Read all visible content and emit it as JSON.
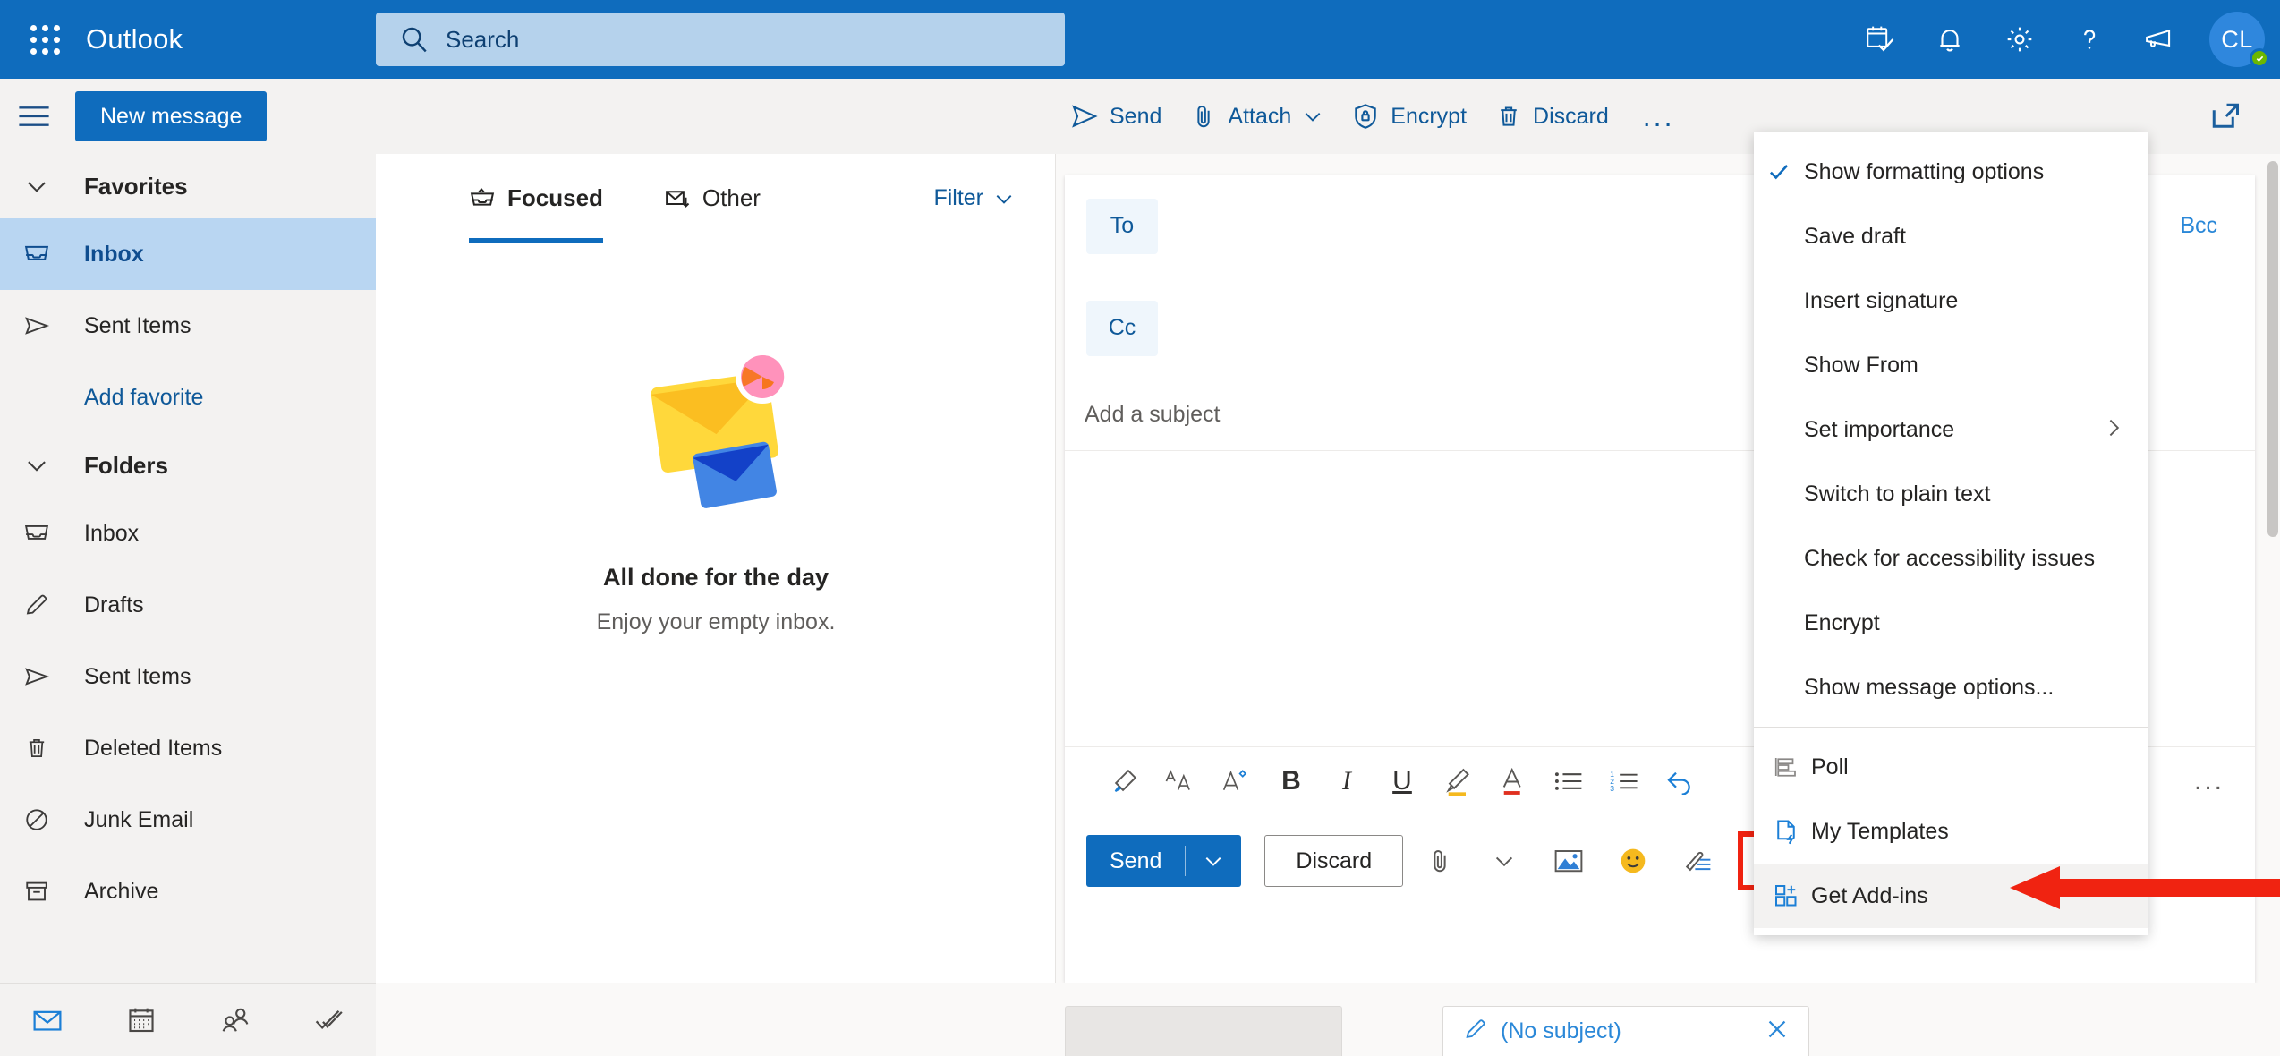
{
  "header": {
    "waffle_label": "app-launcher",
    "brand": "Outlook",
    "search": {
      "placeholder": "Search",
      "value": ""
    },
    "icons": [
      {
        "name": "calendar-check-icon",
        "label": "My day"
      },
      {
        "name": "bell-icon",
        "label": "Notifications"
      },
      {
        "name": "gear-icon",
        "label": "Settings"
      },
      {
        "name": "help-icon",
        "label": "Help"
      },
      {
        "name": "megaphone-icon",
        "label": "Feedback"
      }
    ],
    "avatar": {
      "initials": "CL",
      "presence": "available"
    },
    "accent": "#0f6cbd"
  },
  "command_bar": {
    "new_message": "New message",
    "compose_actions": [
      {
        "name": "send",
        "label": "Send"
      },
      {
        "name": "attach",
        "label": "Attach",
        "has_chevron": true
      },
      {
        "name": "encrypt",
        "label": "Encrypt"
      },
      {
        "name": "discard",
        "label": "Discard"
      }
    ],
    "more_label": "...",
    "popout_label": "Open in new window"
  },
  "sidebar": {
    "favorites": {
      "title": "Favorites",
      "items": [
        {
          "label": "Inbox",
          "icon": "inbox-icon",
          "selected": true
        },
        {
          "label": "Sent Items",
          "icon": "send-icon",
          "selected": false
        }
      ],
      "add_favorite": "Add favorite"
    },
    "folders": {
      "title": "Folders",
      "items": [
        {
          "label": "Inbox",
          "icon": "inbox-icon"
        },
        {
          "label": "Drafts",
          "icon": "pencil-icon"
        },
        {
          "label": "Sent Items",
          "icon": "send-icon"
        },
        {
          "label": "Deleted Items",
          "icon": "trash-icon"
        },
        {
          "label": "Junk Email",
          "icon": "block-icon"
        },
        {
          "label": "Archive",
          "icon": "archive-icon"
        }
      ]
    }
  },
  "message_list": {
    "pivots": [
      {
        "label": "Focused",
        "icon": "focused-inbox-icon",
        "active": true
      },
      {
        "label": "Other",
        "icon": "other-mail-icon",
        "active": false
      }
    ],
    "filter": "Filter",
    "empty_state": {
      "title": "All done for the day",
      "subtitle": "Enjoy your empty inbox.",
      "illustration": "empty-inbox-envelopes"
    }
  },
  "compose": {
    "to": {
      "chip": "To",
      "value": ""
    },
    "cc": {
      "chip": "Cc",
      "value": ""
    },
    "bcc": "Bcc",
    "subject": {
      "placeholder": "Add a subject",
      "value": ""
    },
    "body": {
      "value": ""
    },
    "format_toolbar": [
      {
        "name": "format-painter-icon"
      },
      {
        "name": "font-icon"
      },
      {
        "name": "font-size-icon"
      },
      {
        "name": "bold-icon",
        "glyph": "B"
      },
      {
        "name": "italic-icon",
        "glyph": "I"
      },
      {
        "name": "underline-icon",
        "glyph": "U"
      },
      {
        "name": "highlight-icon"
      },
      {
        "name": "font-color-icon"
      },
      {
        "name": "bulleted-list-icon"
      },
      {
        "name": "numbered-list-icon"
      },
      {
        "name": "undo-icon"
      }
    ],
    "format_more": "...",
    "send_bar": {
      "send": "Send",
      "discard": "Discard",
      "icons": [
        {
          "name": "attach-icon"
        },
        {
          "name": "attach-chevron-icon"
        },
        {
          "name": "insert-picture-icon"
        },
        {
          "name": "emoji-icon"
        },
        {
          "name": "signature-icon"
        }
      ],
      "more": "...",
      "more_highlighted": true,
      "highlight_color": "#f02311"
    }
  },
  "menu": {
    "items": [
      {
        "label": "Show formatting options",
        "checked": true,
        "type": "check"
      },
      {
        "label": "Save draft",
        "type": "plain"
      },
      {
        "label": "Insert signature",
        "type": "plain"
      },
      {
        "label": "Show From",
        "type": "plain"
      },
      {
        "label": "Set importance",
        "type": "plain",
        "submenu": true
      },
      {
        "label": "Switch to plain text",
        "type": "plain"
      },
      {
        "label": "Check for accessibility issues",
        "type": "plain"
      },
      {
        "label": "Encrypt",
        "type": "plain"
      },
      {
        "label": "Show message options...",
        "type": "plain"
      },
      {
        "separator_before": true,
        "label": "Poll",
        "type": "icon",
        "icon": "poll-icon"
      },
      {
        "label": "My Templates",
        "type": "icon",
        "icon": "templates-icon"
      },
      {
        "label": "Get Add-ins",
        "type": "icon",
        "icon": "addins-icon",
        "highlighted": true
      }
    ]
  },
  "annotation": {
    "arrow_color": "#f02311",
    "points_to": "Get Add-ins"
  },
  "bottom": {
    "apps": [
      {
        "name": "mail-app-icon",
        "active": true
      },
      {
        "name": "calendar-app-icon",
        "active": false
      },
      {
        "name": "people-app-icon",
        "active": false
      },
      {
        "name": "todo-app-icon",
        "active": false
      }
    ],
    "draft_tab": {
      "label": "(No subject)",
      "icon": "pencil-icon",
      "close": "close-icon"
    }
  }
}
